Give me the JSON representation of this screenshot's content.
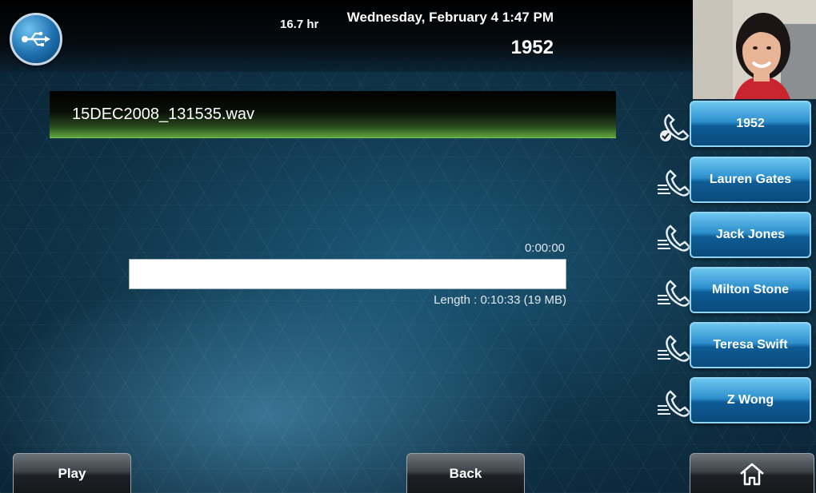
{
  "status": {
    "timer": "16.7 hr",
    "datetime": "Wednesday, February 4  1:47 PM",
    "extension": "1952"
  },
  "recording": {
    "filename": "15DEC2008_131535.wav",
    "position": "0:00:00",
    "length": "Length :   0:10:33 (19 MB)",
    "progress_fraction": 0
  },
  "line_keys": [
    {
      "label": "1952",
      "icon": "registered-line-handset-icon"
    },
    {
      "label": "Lauren Gates",
      "icon": "speed-dial-handset-icon"
    },
    {
      "label": "Jack Jones",
      "icon": "speed-dial-handset-icon"
    },
    {
      "label": "Milton Stone",
      "icon": "speed-dial-handset-icon"
    },
    {
      "label": "Teresa Swift",
      "icon": "speed-dial-handset-icon"
    },
    {
      "label": "Z Wong",
      "icon": "speed-dial-handset-icon"
    }
  ],
  "softkeys": {
    "play": "Play",
    "back": "Back",
    "home_icon": "home-icon"
  },
  "colors": {
    "accent": "#2d8fcc",
    "file_bar_green": "#5ea33c"
  }
}
